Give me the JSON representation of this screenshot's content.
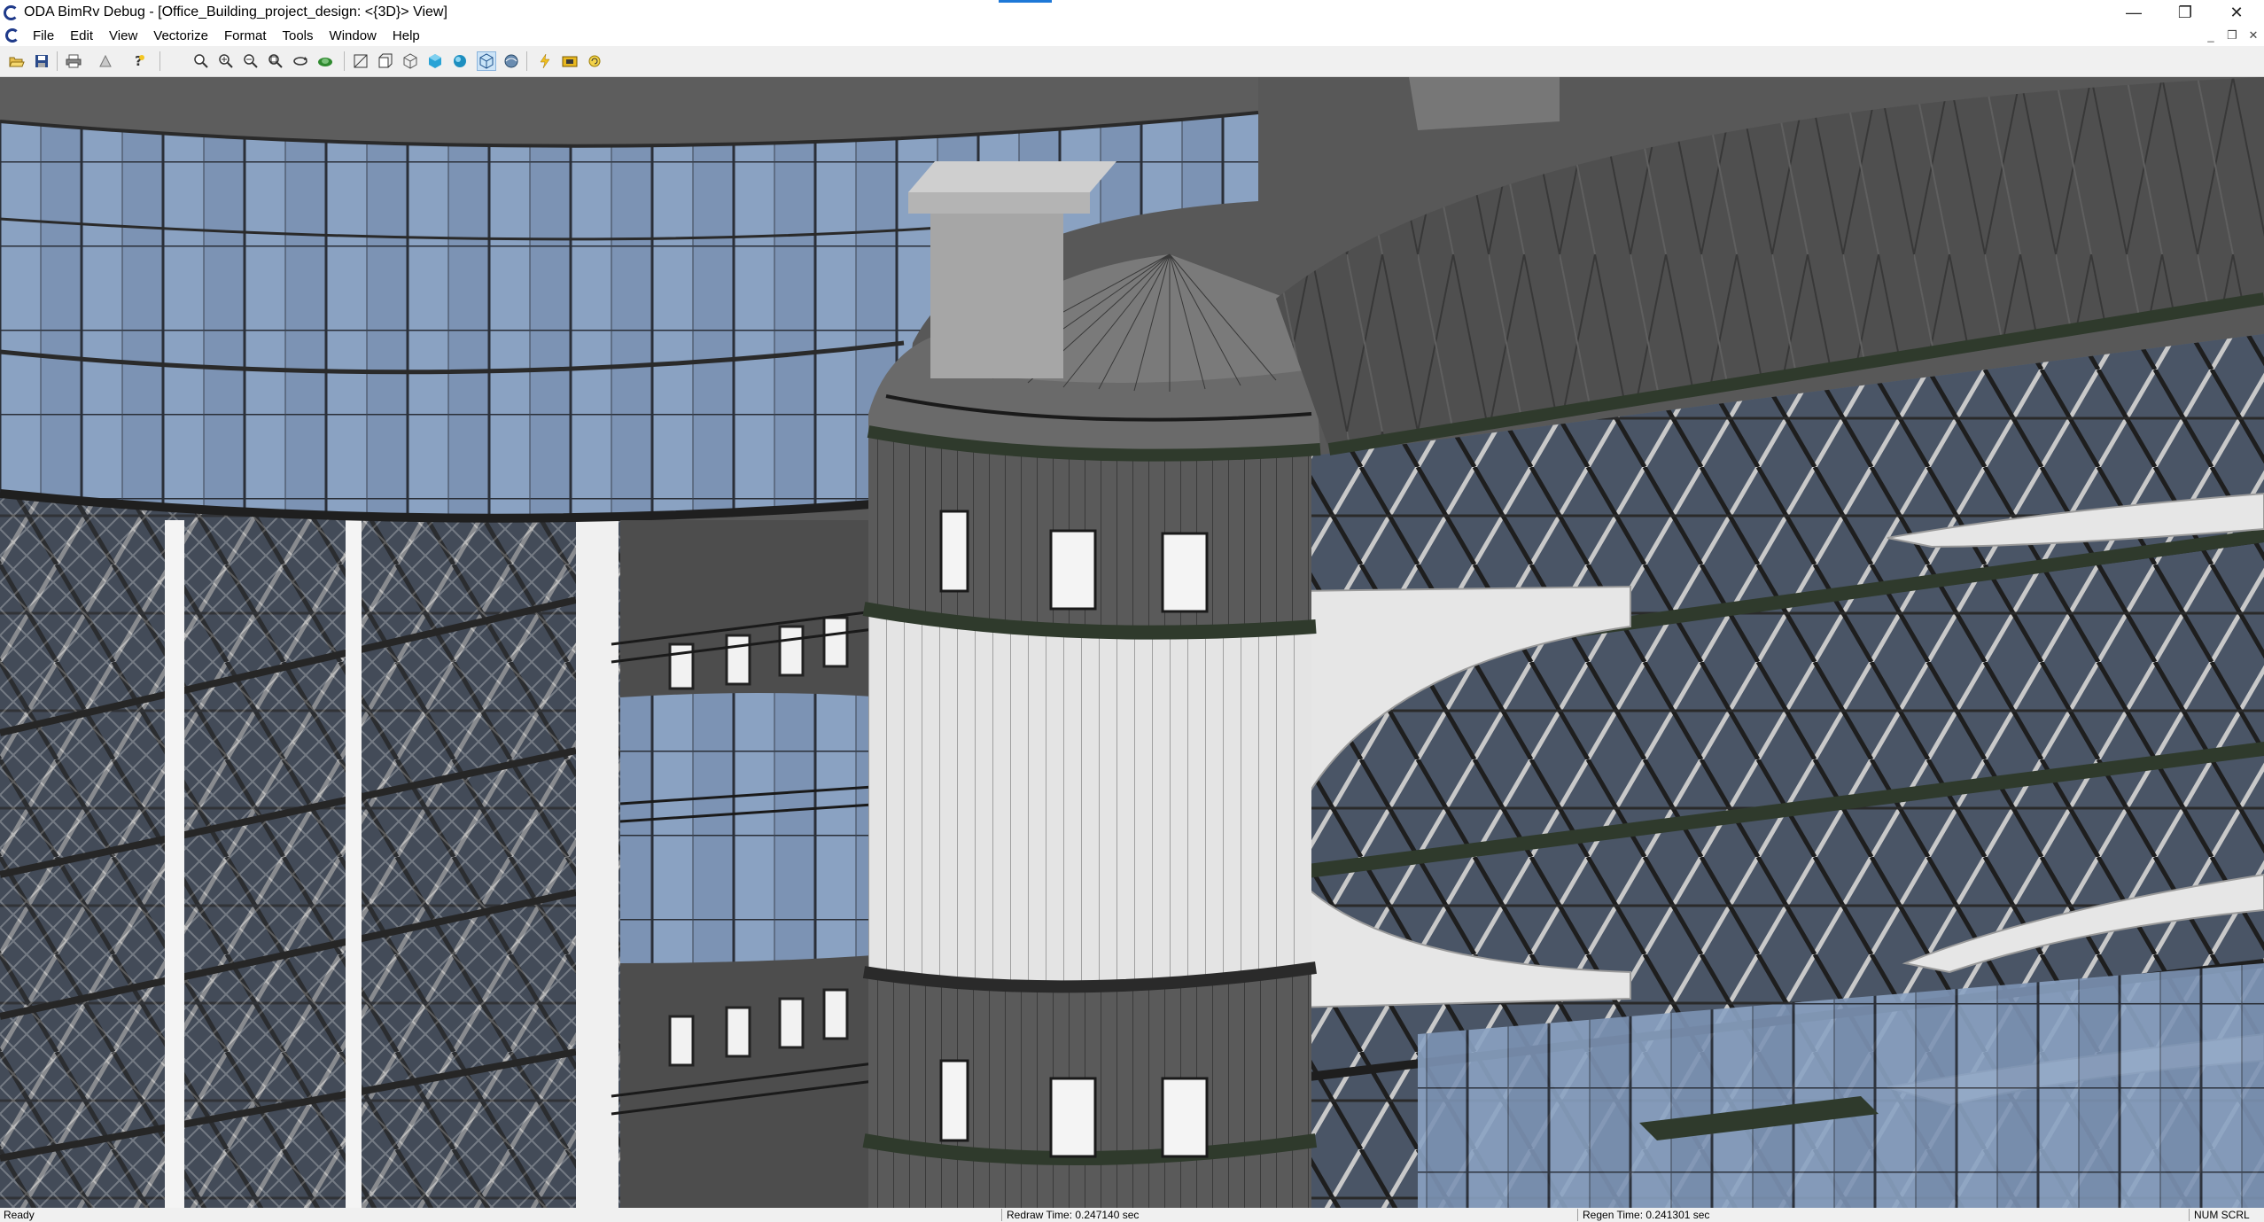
{
  "window": {
    "title": "ODA BimRv Debug - [Office_Building_project_design: <{3D}> View]",
    "controls": {
      "minimize": "—",
      "restore": "❐",
      "close": "✕"
    }
  },
  "menu": {
    "items": [
      "File",
      "Edit",
      "View",
      "Vectorize",
      "Format",
      "Tools",
      "Window",
      "Help"
    ]
  },
  "mdi_controls": {
    "minimize": "_",
    "restore": "❐",
    "close": "✕"
  },
  "toolbar": {
    "buttons": [
      {
        "name": "open-icon"
      },
      {
        "name": "save-icon"
      },
      {
        "name": "print-icon"
      },
      {
        "name": "print-preview-icon"
      },
      {
        "name": "help-icon"
      },
      {
        "name": "zoom-window-icon"
      },
      {
        "name": "zoom-in-icon"
      },
      {
        "name": "zoom-out-icon"
      },
      {
        "name": "zoom-extents-icon"
      },
      {
        "name": "orbit-icon"
      },
      {
        "name": "walk-icon"
      },
      {
        "name": "wireframe-2d-icon"
      },
      {
        "name": "hidden-line-icon"
      },
      {
        "name": "wireframe-3d-icon"
      },
      {
        "name": "flat-shaded-icon"
      },
      {
        "name": "gouraud-shaded-icon"
      },
      {
        "name": "shaded-edges-icon",
        "active": true
      },
      {
        "name": "realistic-icon"
      },
      {
        "name": "lightning-icon"
      },
      {
        "name": "snapshot-icon"
      },
      {
        "name": "refresh-icon"
      }
    ]
  },
  "status": {
    "ready": "Ready",
    "redraw": "Redraw Time: 0.247140 sec",
    "regen": "Regen Time: 0.241301 sec",
    "indicators": "NUM  SCRL"
  },
  "colors": {
    "accent": "#1e78d7",
    "logo": "#1f3a8a",
    "glass": "#7b93b3",
    "facade_dark": "#3e3e3e",
    "panel_light": "#e3e3e3",
    "planting": "#2f3a2c"
  }
}
